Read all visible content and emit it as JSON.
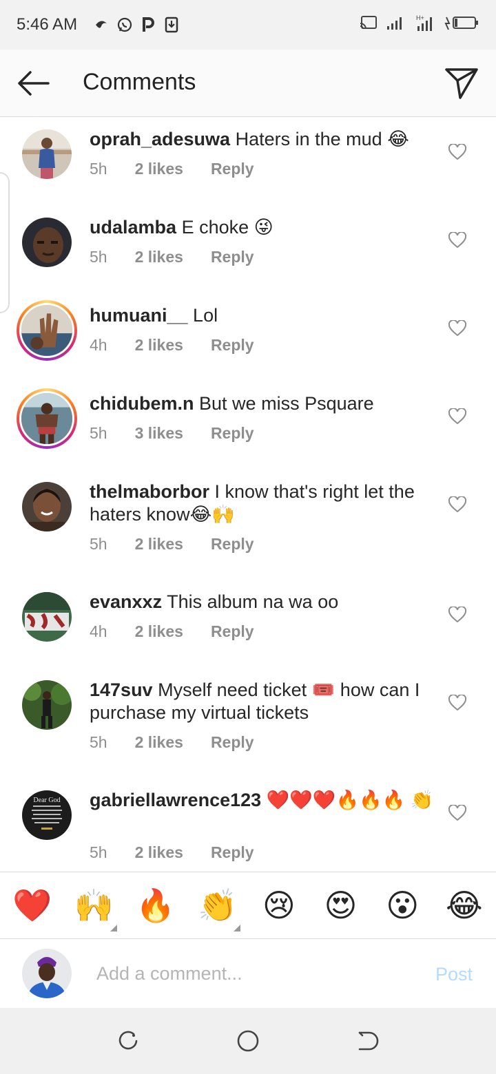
{
  "status_bar": {
    "time": "5:46 AM",
    "icons": [
      "notif-icon",
      "whatsapp-icon",
      "p-icon",
      "download-icon",
      "cast-icon",
      "signal-icon",
      "signal2-icon",
      "battery-icon"
    ]
  },
  "header": {
    "title": "Comments"
  },
  "comments": [
    {
      "username": "oprah_adesuwa",
      "text": "Haters in the mud 😂",
      "time": "5h",
      "likes": "2 likes",
      "reply": "Reply"
    },
    {
      "username": "udalamba",
      "text": "E choke 😜",
      "time": "5h",
      "likes": "2 likes",
      "reply": "Reply"
    },
    {
      "username": "humuani__",
      "text": "Lol",
      "time": "4h",
      "likes": "2 likes",
      "reply": "Reply"
    },
    {
      "username": "chidubem.n",
      "text": "But we miss Psquare",
      "time": "5h",
      "likes": "3 likes",
      "reply": "Reply"
    },
    {
      "username": "thelmaborbor",
      "text": "I know that's right let the haters know😂🙌",
      "time": "5h",
      "likes": "2 likes",
      "reply": "Reply"
    },
    {
      "username": "evanxxz",
      "text": "This album na wa oo",
      "time": "4h",
      "likes": "2 likes",
      "reply": "Reply"
    },
    {
      "username": "147suv",
      "text": "Myself need ticket 🎟️ how can I purchase my virtual tickets",
      "time": "5h",
      "likes": "2 likes",
      "reply": "Reply"
    },
    {
      "username": "gabriellawrence123",
      "text": "❤️❤️❤️🔥🔥🔥 👏",
      "time": "5h",
      "likes": "2 likes",
      "reply": "Reply"
    }
  ],
  "avatar_texts": {
    "gabriellawrence123": "Dear God"
  },
  "quick_emojis": [
    "❤️",
    "🙌",
    "🔥",
    "👏",
    "😢",
    "😍",
    "😮",
    "😂"
  ],
  "comment_box": {
    "placeholder": "Add a comment...",
    "post_label": "Post"
  },
  "colors": {
    "post_disabled": "#b3dbff",
    "meta_grey": "#8e8e8e",
    "heart_red": "#ed4956"
  }
}
